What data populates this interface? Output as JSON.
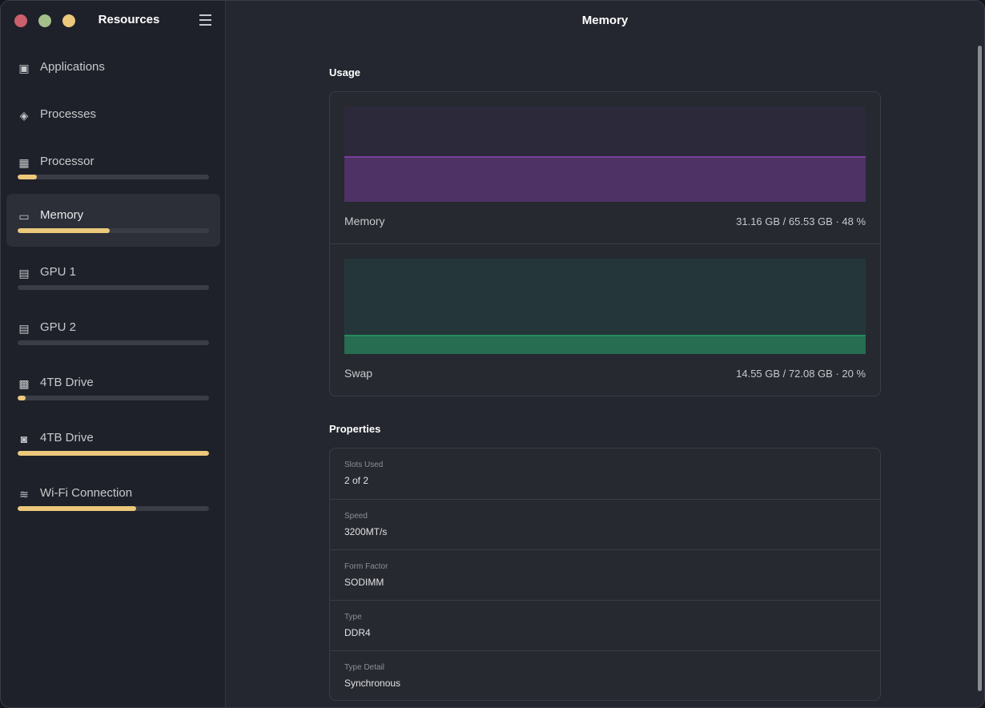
{
  "app": {
    "title": "Resources",
    "colors": {
      "close": "#c9606b",
      "minimize": "#a3c08a",
      "maximize": "#ecc87b",
      "accent": "#ecc87b"
    }
  },
  "sidebar": {
    "items": [
      {
        "label": "Applications",
        "icon": "window-icon",
        "progress": null
      },
      {
        "label": "Processes",
        "icon": "processes-icon",
        "progress": null
      },
      {
        "label": "Processor",
        "icon": "cpu-icon",
        "progress": 0.1
      },
      {
        "label": "Memory",
        "icon": "memory-icon",
        "progress": 0.48,
        "selected": true
      },
      {
        "label": "GPU 1",
        "icon": "gpu-icon",
        "progress": 0
      },
      {
        "label": "GPU 2",
        "icon": "gpu-icon",
        "progress": 0
      },
      {
        "label": "4TB Drive",
        "icon": "ssd-icon",
        "progress": 0.04
      },
      {
        "label": "4TB Drive",
        "icon": "hdd-icon",
        "progress": 1.0
      },
      {
        "label": "Wi-Fi Connection",
        "icon": "wifi-icon",
        "progress": 0.62
      }
    ]
  },
  "main": {
    "title": "Memory",
    "usage": {
      "heading": "Usage",
      "memory": {
        "label": "Memory",
        "value": "31.16 GB / 65.53 GB · 48 %",
        "percent": 48,
        "color": "#7a3f9a"
      },
      "swap": {
        "label": "Swap",
        "value": "14.55 GB / 72.08 GB · 20 %",
        "percent": 20,
        "color": "#2a8a5c"
      }
    },
    "properties": {
      "heading": "Properties",
      "rows": [
        {
          "key": "Slots Used",
          "value": "2 of 2"
        },
        {
          "key": "Speed",
          "value": "3200MT/s"
        },
        {
          "key": "Form Factor",
          "value": "SODIMM"
        },
        {
          "key": "Type",
          "value": "DDR4"
        },
        {
          "key": "Type Detail",
          "value": "Synchronous"
        }
      ]
    }
  }
}
